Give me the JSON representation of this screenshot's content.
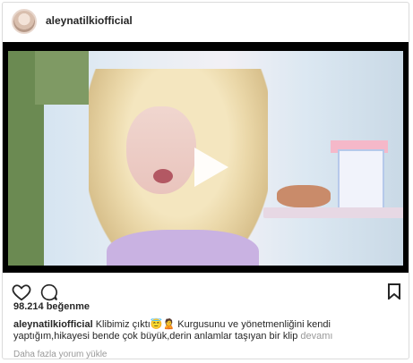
{
  "post": {
    "username": "aleynatilkiofficial",
    "likes": "98.214 beğenme",
    "caption_username": "aleynatilkiofficial",
    "caption_text": "Klibimiz çıktı😇🙎 Kurgusunu ve yönetmenliğini kendi yaptığım,hikayesi bende çok büyük,derin anlamlar taşıyan bir klip",
    "more_label": "devamı",
    "view_comments": "Daha fazla yorum yükle"
  },
  "icons": {
    "like": "heart-outline-icon",
    "comment": "comment-bubble-icon",
    "save": "bookmark-icon",
    "play": "play-icon"
  },
  "colors": {
    "text": "#262626",
    "muted": "#999999",
    "border": "#dbdbdb"
  }
}
